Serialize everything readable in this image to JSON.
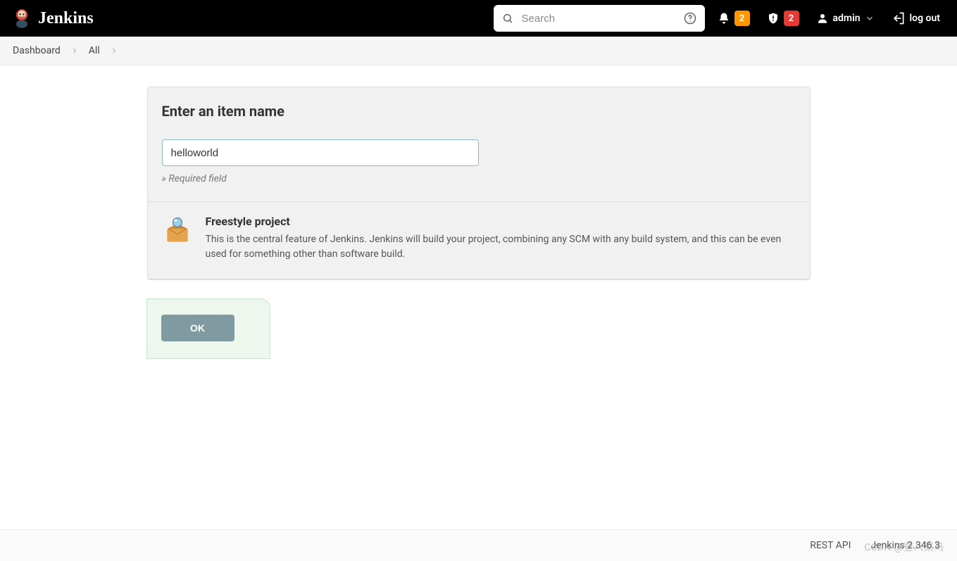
{
  "brand": {
    "name": "Jenkins"
  },
  "search": {
    "placeholder": "Search"
  },
  "notifications": {
    "count": "2"
  },
  "security": {
    "count": "2"
  },
  "user": {
    "name": "admin"
  },
  "logout": {
    "label": "log out"
  },
  "breadcrumbs": {
    "items": [
      "Dashboard",
      "All"
    ]
  },
  "form": {
    "heading": "Enter an item name",
    "value": "helloworld",
    "hint": "» Required field"
  },
  "itemTypes": [
    {
      "title": "Freestyle project",
      "description": "This is the central feature of Jenkins. Jenkins will build your project, combining any SCM with any build system, and this can be even used for something other than software build."
    }
  ],
  "actions": {
    "ok": "OK"
  },
  "footer": {
    "restApi": "REST API",
    "version": "Jenkins 2.346.3"
  },
  "watermark": "CSDN @登八菜鸟"
}
